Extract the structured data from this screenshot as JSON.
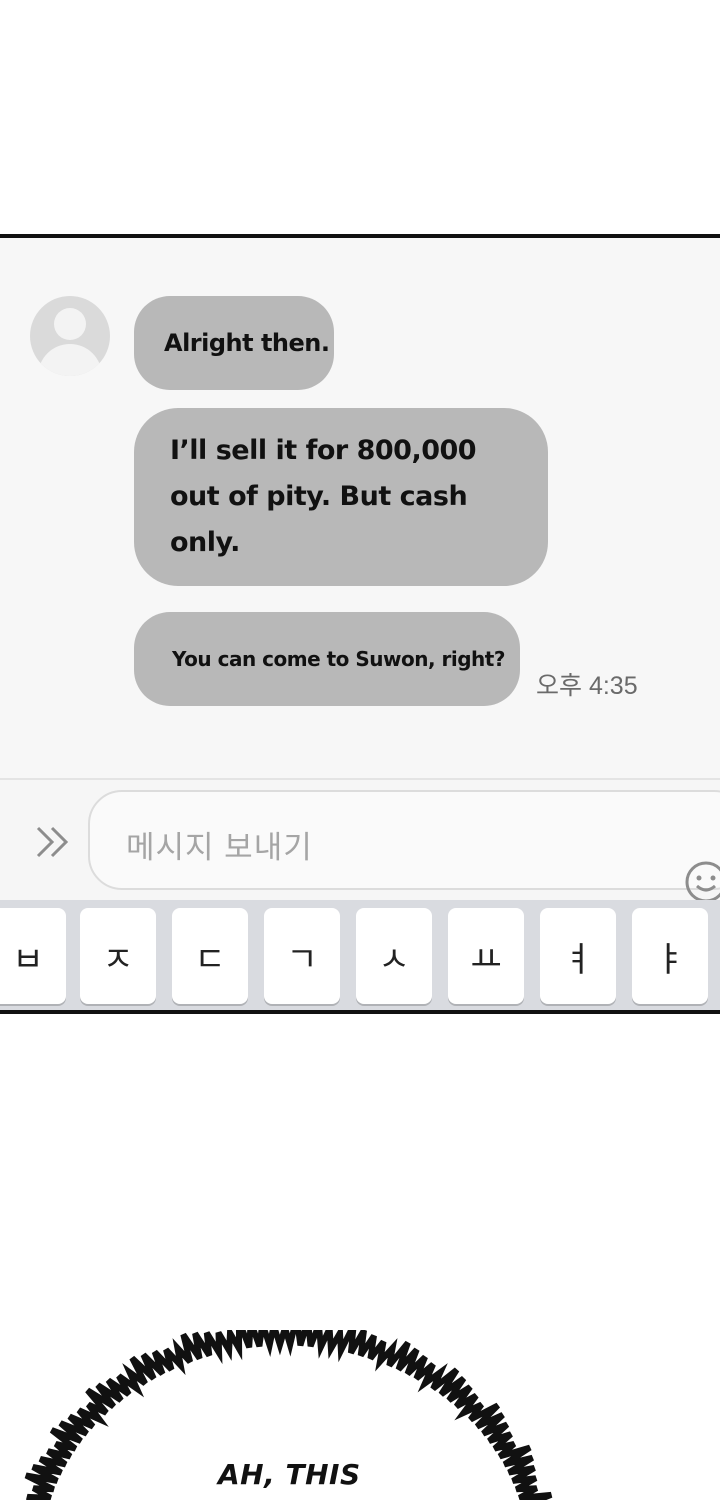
{
  "chat": {
    "messages": [
      {
        "text": "Alright then."
      },
      {
        "text": "I’ll sell it for 800,000 out of pity. But cash only."
      },
      {
        "text": "You can come to Suwon, right?"
      }
    ],
    "timestamp": "오후 4:35"
  },
  "composer": {
    "placeholder": "메시지 보내기",
    "expand_icon": "double-chevron-right-icon",
    "emoji_icon": "smiley-icon"
  },
  "keyboard": {
    "keys": [
      "ㅂ",
      "ㅈ",
      "ㄷ",
      "ㄱ",
      "ㅅ",
      "ㅛ",
      "ㅕ",
      "ㅑ"
    ]
  },
  "narration": {
    "caption": "AH, THIS"
  },
  "colors": {
    "bubble": "#b8b8b8",
    "chat_background": "#f7f7f7",
    "panel_border": "#111111",
    "keyboard_background": "#d9dbe0"
  }
}
